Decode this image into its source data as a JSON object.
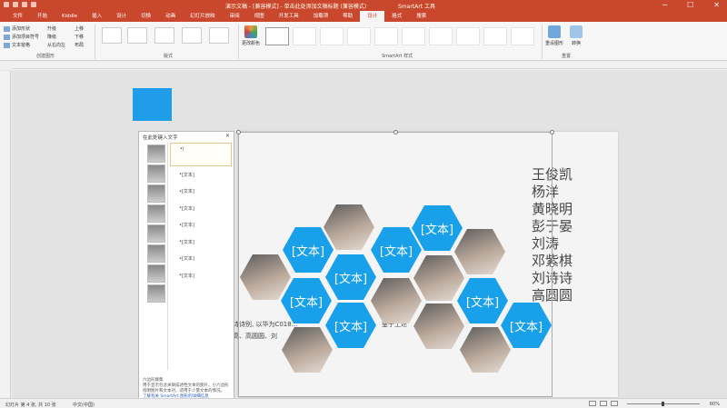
{
  "window": {
    "title": "演示文稿 - [兼容模式] - 单击此处添加文稿标题 (兼容模式)",
    "context_tool": "SmartArt 工具",
    "controls": [
      "─",
      "☐",
      "✕"
    ]
  },
  "menu": {
    "tabs": [
      "文件",
      "开始",
      "Kiddle",
      "插入",
      "设计",
      "切换",
      "动画",
      "幻灯片放映",
      "审阅",
      "视图",
      "开发工具",
      "加载项",
      "帮助",
      "设计",
      "格式",
      "搜索"
    ]
  },
  "ribbon": {
    "create_graphic": {
      "label": "创建图形",
      "items": [
        "添加形状",
        "添加项目符号",
        "文本窗格",
        "升级",
        "降级",
        "从右向左",
        "上移",
        "下移",
        "布局"
      ]
    },
    "layouts_label": "版式",
    "change_colors": "更改颜色",
    "smartart_styles_label": "SmartArt 样式",
    "reset": {
      "label": "重置",
      "items": [
        "重设图形",
        "转换"
      ]
    }
  },
  "text_pane": {
    "title": "在此处键入文字",
    "close": "×",
    "first_entry": "|",
    "entries": [
      "[文本]",
      "[文本]",
      "[文本]",
      "[文本]",
      "[文本]",
      "[文本]",
      "[文本]"
    ],
    "footer_title": "六边形群集",
    "footer_desc": "用于显示包含关联描述性文本的图片。小六边形指明图片和文本对。适用于少量文本的情况。",
    "footer_link": "了解有关 SmartArt 图形的详细信息"
  },
  "slide": {
    "names": [
      "王俊凯",
      "杨洋",
      "黄晓明",
      "彭于晏",
      "刘涛",
      "邓紫棋",
      "刘诗诗",
      "高圆圆"
    ],
    "hex_text": "[文本]",
    "behind_text_1": "诗诗别, 以华为C018...",
    "behind_text_2": "高、高圆圆、刘",
    "behind_text_3": "鉴于上述"
  },
  "status": {
    "slide_info": "幻灯片 第 4 张, 共 10 张",
    "language": "中文(中国)",
    "zoom": "60%"
  }
}
